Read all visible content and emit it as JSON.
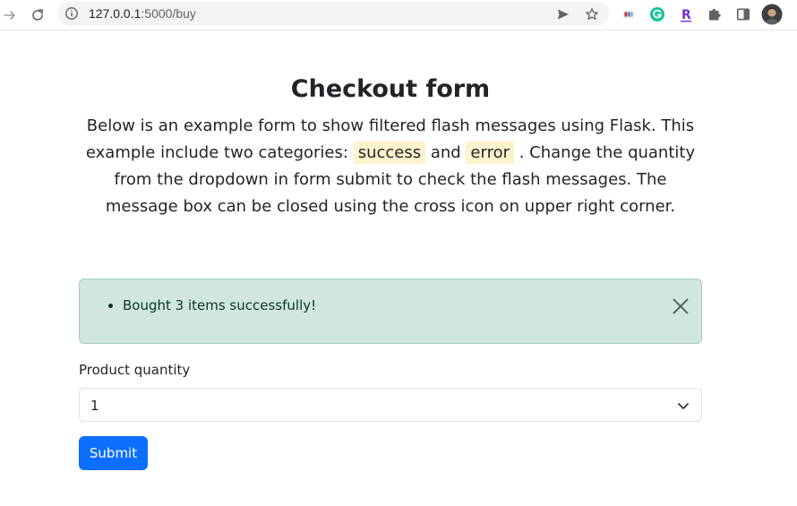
{
  "browser": {
    "url_host": "127.0.0.1",
    "url_rest": ":5000/buy",
    "icons": [
      "forward-arrow-icon",
      "reload-icon",
      "site-info-icon",
      "send-tab-icon",
      "bookmark-star-icon",
      "mail-extension-icon",
      "grammarly-icon",
      "r-extension-icon",
      "extensions-puzzle-icon",
      "side-panel-icon",
      "profile-avatar"
    ],
    "colors": {
      "grammarly": "#15c39a",
      "r_extension": "#7b2fd6"
    }
  },
  "page": {
    "heading": "Checkout form",
    "lead": {
      "part1": "Below is an example form to show filtered flash messages using Flask. This example include two categories: ",
      "mark1": "success",
      "part2": " and ",
      "mark2": "error",
      "part3": " . Change the quantity from the dropdown in form submit to check the flash messages. The message box can be closed using the cross icon on upper right corner."
    },
    "alert": {
      "messages": [
        "Bought 3 items successfully!"
      ],
      "close_icon": "close-icon"
    },
    "form": {
      "quantity_label": "Product quantity",
      "quantity_value": "1",
      "submit_label": "Submit"
    },
    "colors": {
      "primary": "#0d6efd",
      "alert_bg": "#d1e7dd",
      "alert_text": "#0a3622",
      "mark_bg": "#fff3cd"
    }
  }
}
